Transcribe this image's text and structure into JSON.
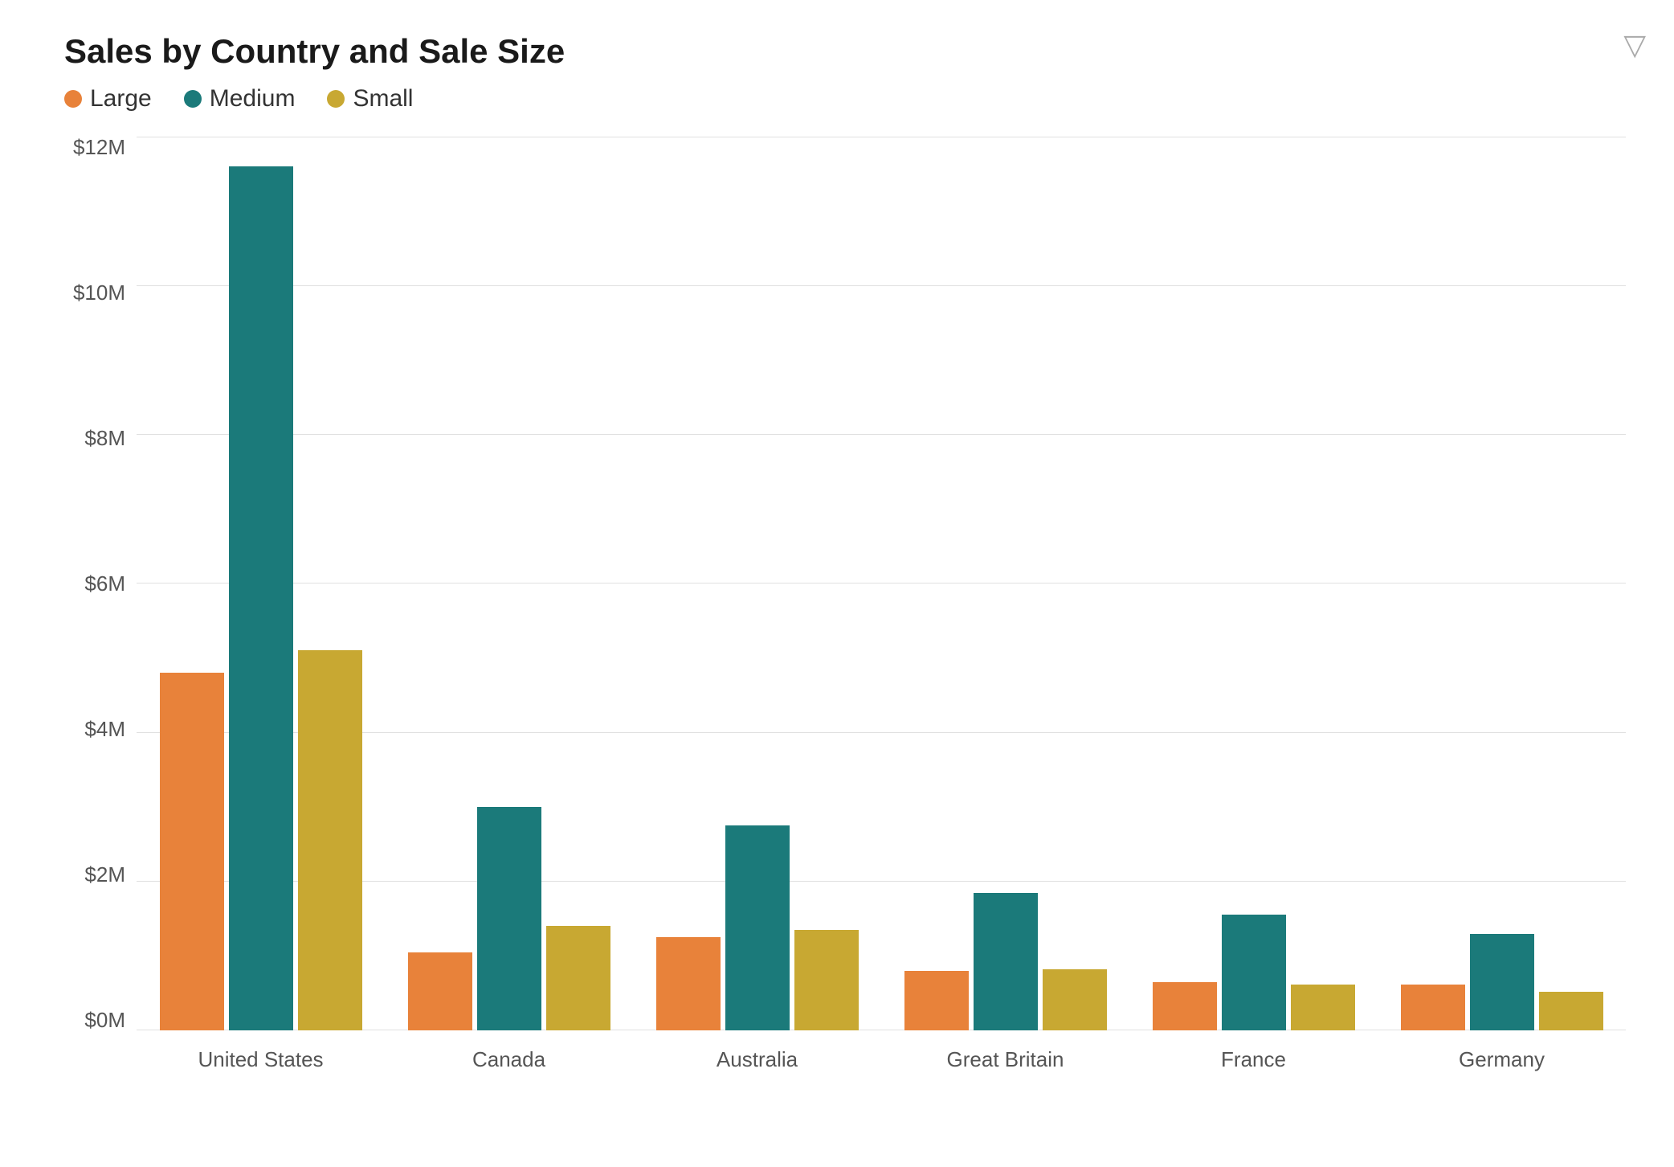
{
  "chart": {
    "title": "Sales by Country and Sale Size",
    "filter_icon": "▽",
    "legend": [
      {
        "label": "Large",
        "color": "#E8823A",
        "dot": true
      },
      {
        "label": "Medium",
        "color": "#1B7A7A",
        "dot": true
      },
      {
        "label": "Small",
        "color": "#C8A832",
        "dot": true
      }
    ],
    "y_axis": {
      "labels": [
        "$0M",
        "$2M",
        "$4M",
        "$6M",
        "$8M",
        "$10M",
        "$12M"
      ]
    },
    "max_value": 12,
    "countries": [
      {
        "name": "United States",
        "large": 4.8,
        "medium": 11.6,
        "small": 5.1
      },
      {
        "name": "Canada",
        "large": 1.05,
        "medium": 3.0,
        "small": 1.4
      },
      {
        "name": "Australia",
        "large": 1.25,
        "medium": 2.75,
        "small": 1.35
      },
      {
        "name": "Great Britain",
        "large": 0.8,
        "medium": 1.85,
        "small": 0.82
      },
      {
        "name": "France",
        "large": 0.65,
        "medium": 1.55,
        "small": 0.62
      },
      {
        "name": "Germany",
        "large": 0.62,
        "medium": 1.3,
        "small": 0.52
      }
    ],
    "colors": {
      "large": "#E8823A",
      "medium": "#1B7A7A",
      "small": "#C8A832"
    }
  }
}
